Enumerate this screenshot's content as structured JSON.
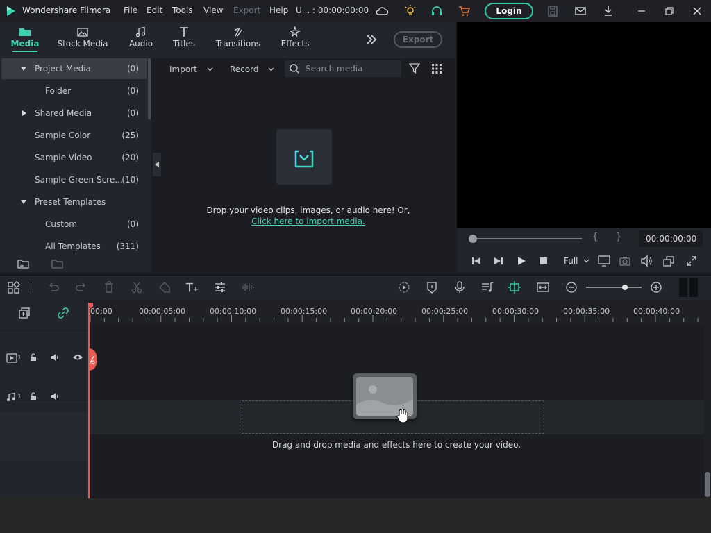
{
  "app": {
    "title": "Wondershare Filmora",
    "brand_color": "#3ed3b0"
  },
  "menu": {
    "file": "File",
    "edit": "Edit",
    "tools": "Tools",
    "view": "View",
    "export": "Export",
    "help": "Help",
    "project_name": "U... : 00:00:00:00",
    "login": "Login"
  },
  "media_tabs": [
    {
      "label": "Media",
      "icon": "folder-icon"
    },
    {
      "label": "Stock Media",
      "icon": "stock-image-icon"
    },
    {
      "label": "Audio",
      "icon": "music-note-icon"
    },
    {
      "label": "Titles",
      "icon": "text-t-icon"
    },
    {
      "label": "Transitions",
      "icon": "transition-icon"
    },
    {
      "label": "Effects",
      "icon": "sparkle-icon"
    }
  ],
  "export_button": "Export",
  "sidebar": {
    "items": [
      {
        "label": "Project Media",
        "count": "(0)"
      },
      {
        "label": "Folder",
        "count": "(0)"
      },
      {
        "label": "Shared Media",
        "count": "(0)"
      },
      {
        "label": "Sample Color",
        "count": "(25)"
      },
      {
        "label": "Sample Video",
        "count": "(20)"
      },
      {
        "label": "Sample Green Scre...",
        "count": "(10)"
      },
      {
        "label": "Preset Templates",
        "count": ""
      },
      {
        "label": "Custom",
        "count": "(0)"
      },
      {
        "label": "All Templates",
        "count": "(311)"
      }
    ]
  },
  "media_toolbar": {
    "import": "Import",
    "record": "Record",
    "search_placeholder": "Search media"
  },
  "media_area": {
    "drop_text": "Drop your video clips, images, or audio here! Or,",
    "import_link": "Click here to import media."
  },
  "preview": {
    "mark_in": "{",
    "mark_out": "}",
    "timecode": "00:00:00:00",
    "quality": "Full",
    "progress": 0
  },
  "timeline": {
    "ruler_labels": [
      "00:00",
      "00:00:05:00",
      "00:00:10:00",
      "00:00:15:00",
      "00:00:20:00",
      "00:00:25:00",
      "00:00:30:00",
      "00:00:35:00",
      "00:00:40:00"
    ],
    "video_track": "1",
    "audio_track": "1",
    "drop_hint": "Drag and drop media and effects here to create your video.",
    "zoom_level": 0.7
  }
}
